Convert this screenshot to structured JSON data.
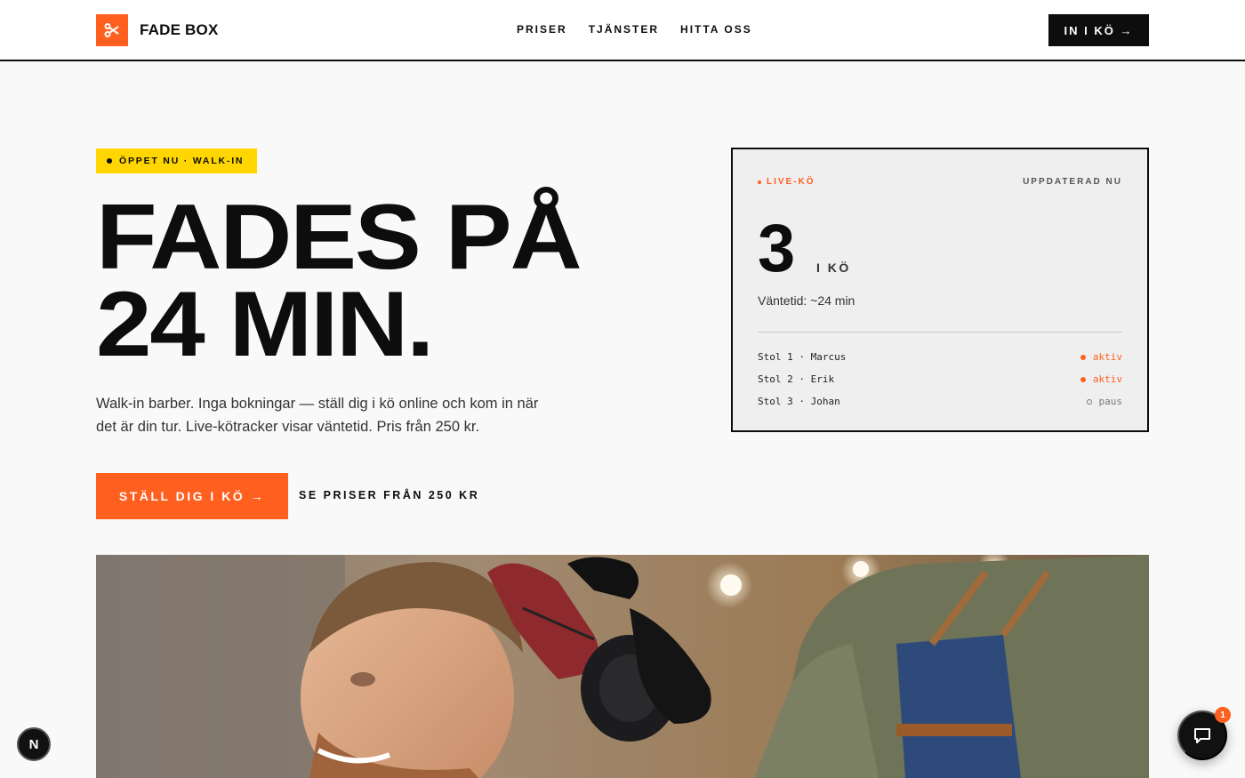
{
  "header": {
    "brand": "FADE BOX",
    "nav": [
      "PRISER",
      "TJÄNSTER",
      "HITTA OSS"
    ],
    "cta_label": "IN I KÖ →"
  },
  "hero": {
    "badge": "ÖPPET NU · WALK-IN",
    "headline_line1": "FADES PÅ",
    "headline_line2": "24 MIN.",
    "lead": "Walk-in barber. Inga bokningar — ställ dig i kö online och kom in när det är din tur. Live-kötracker visar väntetid. Pris från 250 kr.",
    "primary_cta": "STÄLL DIG I KÖ →",
    "secondary_cta": "SE PRISER FRÅN 250 KR"
  },
  "queue": {
    "live_label": "LIVE-KÖ",
    "updated_label": "UPPDATERAD NU",
    "count": "3",
    "unit": "I KÖ",
    "wait": "Väntetid: ~24 min",
    "chairs": [
      {
        "label": "Stol 1 · Marcus",
        "status": "aktiv",
        "state": "active"
      },
      {
        "label": "Stol 2 · Erik",
        "status": "aktiv",
        "state": "active"
      },
      {
        "label": "Stol 3 · Johan",
        "status": "paus",
        "state": "paused"
      }
    ]
  },
  "floating": {
    "n_badge": "N",
    "chat_unread": "1"
  },
  "colors": {
    "accent": "#ff5f1f",
    "badge_yellow": "#ffd600",
    "ink": "#0d0d0d",
    "background": "#f9f9f9"
  },
  "icons": {
    "logo": "scissors-icon",
    "chat": "chat-bubble-icon"
  }
}
